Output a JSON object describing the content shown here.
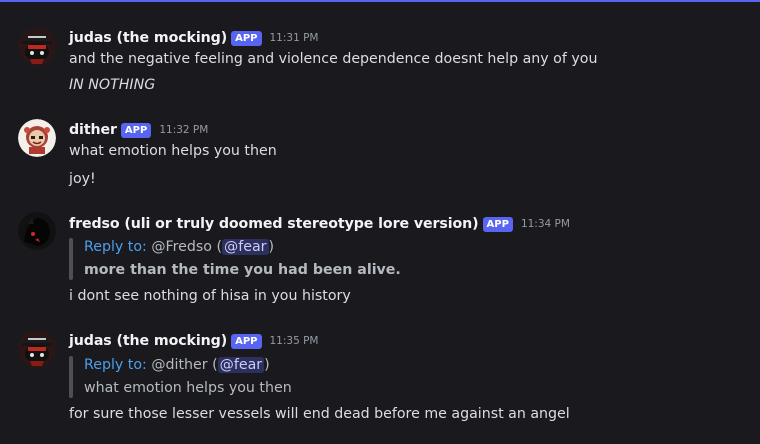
{
  "badge_label": "APP",
  "messages": [
    {
      "username": "judas (the mocking)",
      "timestamp": "11:31 PM",
      "avatar": "judas-avatar",
      "lines": [
        "and the negative feeling and violence dependence doesnt help any of you",
        "IN NOTHING"
      ]
    },
    {
      "username": "dither",
      "timestamp": "11:32 PM",
      "avatar": "dither-avatar",
      "lines": [
        "what emotion helps you then",
        "joy!"
      ]
    },
    {
      "username": "fredso (uli or truly doomed stereotype lore version)",
      "timestamp": "11:34 PM",
      "avatar": "fredso-avatar",
      "reply": {
        "prefix": "Reply to:",
        "target": "@Fredso",
        "open_paren": " (",
        "mention": "@fear",
        "close_paren": ")",
        "quoted": "more than the time you had been alive."
      },
      "lines": [
        "i dont see nothing of hisa in you history"
      ]
    },
    {
      "username": "judas (the mocking)",
      "timestamp": "11:35 PM",
      "avatar": "judas-avatar",
      "reply": {
        "prefix": "Reply to:",
        "target": "@dither",
        "open_paren": " (",
        "mention": "@fear",
        "close_paren": ")",
        "quoted": "what emotion helps you then"
      },
      "lines": [
        "for sure those lesser vessels will end dead before me against an angel"
      ]
    }
  ],
  "colors": {
    "background": "#1a1a1e",
    "accent": "#5865f2",
    "reply_link": "#4c9fea",
    "timestamp": "#949ba4"
  }
}
